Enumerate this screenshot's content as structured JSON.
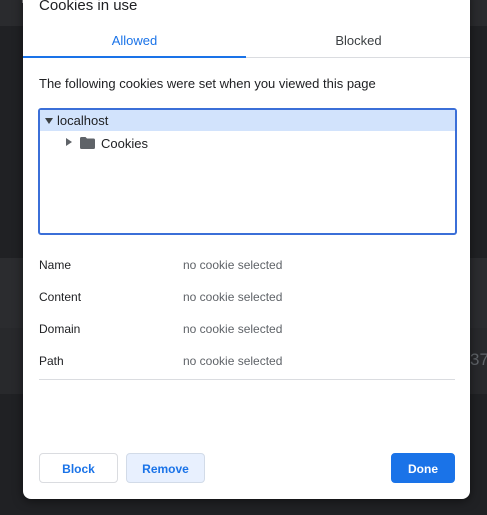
{
  "background": {
    "partial_text": "37"
  },
  "dialog": {
    "title": "Cookies in use",
    "tabs": [
      {
        "label": "Allowed",
        "selected": true
      },
      {
        "label": "Blocked",
        "selected": false
      }
    ],
    "description": "The following cookies were set when you viewed this page",
    "tree": {
      "host": "localhost",
      "children": [
        {
          "label": "Cookies",
          "icon": "folder-icon"
        }
      ]
    },
    "details": [
      {
        "key": "Name",
        "value": "no cookie selected"
      },
      {
        "key": "Content",
        "value": "no cookie selected"
      },
      {
        "key": "Domain",
        "value": "no cookie selected"
      },
      {
        "key": "Path",
        "value": "no cookie selected"
      }
    ],
    "buttons": {
      "block": "Block",
      "remove": "Remove",
      "done": "Done"
    }
  },
  "colors": {
    "accent": "#1a73e8",
    "selection": "#d2e3fc",
    "focus_border": "#3b6fd8"
  }
}
